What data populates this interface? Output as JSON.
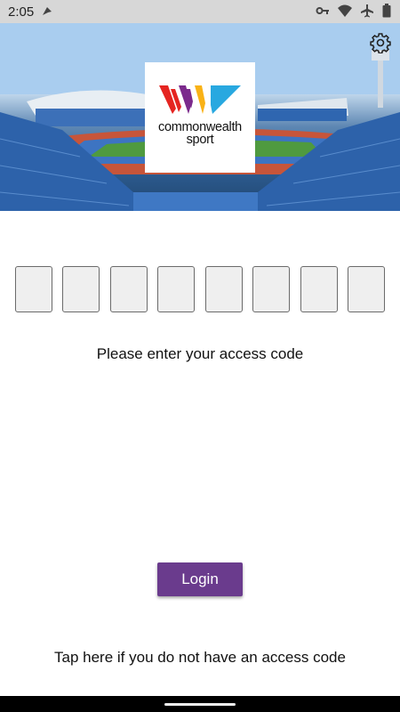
{
  "status_bar": {
    "time": "2:05",
    "icons": [
      "notification-icon",
      "vpn-key-icon",
      "wifi-icon",
      "airplane-mode-icon",
      "battery-icon"
    ]
  },
  "header": {
    "logo_line1": "commonwealth",
    "logo_line2": "sport",
    "logo_colors": [
      "#e52521",
      "#7b2a8c",
      "#f9b216",
      "#28a8e0"
    ],
    "settings_icon": "gear-icon"
  },
  "access_code": {
    "box_count": 8,
    "prompt": "Please enter your access code"
  },
  "login": {
    "label": "Login",
    "color": "#6a3b8d"
  },
  "no_code_link": "Tap here if you do not have an access code"
}
